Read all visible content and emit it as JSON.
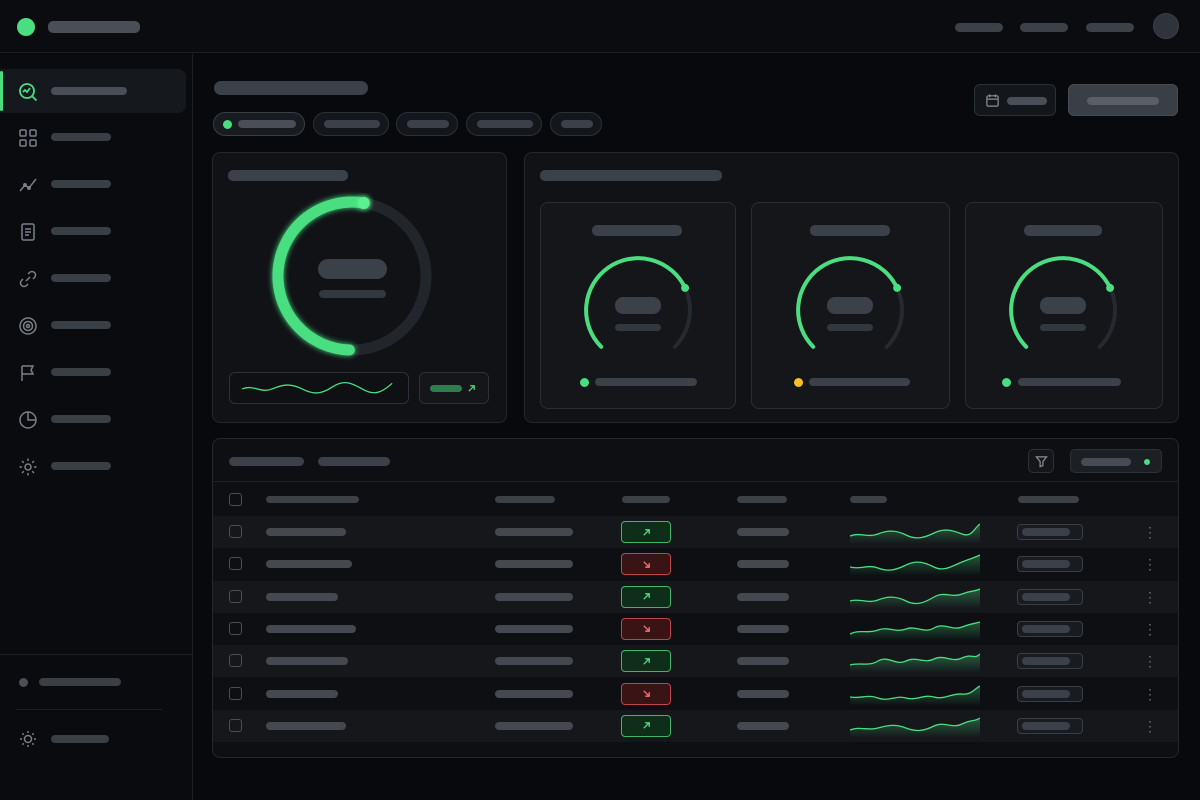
{
  "colors": {
    "accent": "#4ade80",
    "warning": "#fbbf24",
    "danger": "#f87171",
    "background": "#07090c",
    "surface": "#101216"
  },
  "topbar": {
    "logo_icon": "logo-dot-icon",
    "nav_links": [
      "",
      "",
      ""
    ],
    "avatar_icon": "user-avatar-icon"
  },
  "sidebar": {
    "items": [
      {
        "icon": "analytics-search-icon",
        "active": true
      },
      {
        "icon": "grid-icon",
        "active": false
      },
      {
        "icon": "line-chart-icon",
        "active": false
      },
      {
        "icon": "document-icon",
        "active": false
      },
      {
        "icon": "link-icon",
        "active": false
      },
      {
        "icon": "target-icon",
        "active": false
      },
      {
        "icon": "flag-icon",
        "active": false
      },
      {
        "icon": "pie-chart-icon",
        "active": false
      },
      {
        "icon": "gear-icon",
        "active": false
      }
    ],
    "footer": {
      "status_icon": "status-dot-icon",
      "theme_icon": "sun-icon"
    }
  },
  "toolbar": {
    "date_icon": "calendar-icon",
    "filter_chips": [
      {
        "active": true
      },
      {
        "active": false
      },
      {
        "active": false
      },
      {
        "active": false
      },
      {
        "active": false
      }
    ]
  },
  "overview_gauge": {
    "progress": 0.52,
    "trend_icon": "arrow-up-right-icon"
  },
  "gauges": [
    {
      "progress": 0.74,
      "status": "ok"
    },
    {
      "progress": 0.74,
      "status": "warning"
    },
    {
      "progress": 0.74,
      "status": "ok"
    }
  ],
  "table": {
    "filter_icon": "filter-icon",
    "rows": [
      {
        "trend": "up"
      },
      {
        "trend": "down"
      },
      {
        "trend": "up"
      },
      {
        "trend": "down"
      },
      {
        "trend": "up"
      },
      {
        "trend": "down"
      },
      {
        "trend": "up"
      }
    ]
  }
}
